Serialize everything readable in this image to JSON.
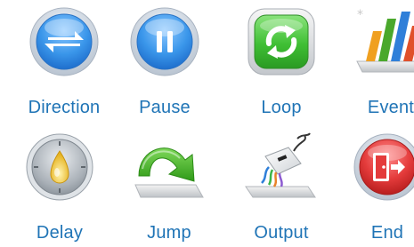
{
  "palette": {
    "items": [
      {
        "label": "Direction",
        "icon": "direction-arrows-icon",
        "color": "#2f8ee6"
      },
      {
        "label": "Pause",
        "icon": "pause-icon",
        "color": "#2f8ee6"
      },
      {
        "label": "Loop",
        "icon": "loop-arrows-icon",
        "color": "#43c23c"
      },
      {
        "label": "Event",
        "icon": "event-bars-icon",
        "color": "#e8552a"
      },
      {
        "label": "Delay",
        "icon": "stopwatch-icon",
        "color": "#e8c23a"
      },
      {
        "label": "Jump",
        "icon": "jump-arrow-icon",
        "color": "#3fb51f"
      },
      {
        "label": "Output",
        "icon": "output-cables-icon",
        "color": "#8a8a8a"
      },
      {
        "label": "End",
        "icon": "exit-door-icon",
        "color": "#e23b3b"
      }
    ],
    "label_color": "#1f74b6"
  }
}
